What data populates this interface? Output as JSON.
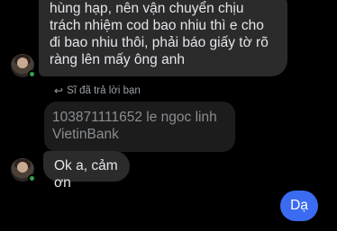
{
  "messages": {
    "first_bubble_text": "hùng hạp, nên vận chuyển chịu\ntrách nhiệm cod bao nhiu thì e cho\nđi bao nhiu thôi, phải báo giấy tờ rõ\nràng lên mấy ông anh",
    "reply_label": "Sĩ đã trả lời bạn",
    "quoted_text_line1": "103871111652 le ngoc linh",
    "quoted_text_line2": "VietinBank",
    "second_bubble_text": "Ok a, cảm ơn",
    "my_message_text": "Dạ"
  },
  "colors": {
    "background": "#000000",
    "incoming_bubble": "#2b2b2b",
    "quoted_bubble": "#1c1c1c",
    "outgoing_bubble": "#3b6bf0",
    "online_dot": "#31a24c"
  },
  "icons": {
    "reply": "reply-arrow-icon"
  }
}
